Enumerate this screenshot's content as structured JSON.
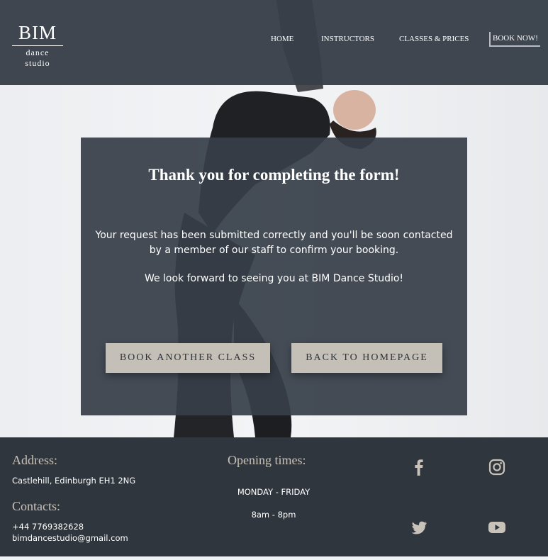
{
  "colors": {
    "header_bg": "#373e48",
    "card_bg": "#373e48",
    "footer_bg": "#30363e",
    "button_bg": "#c4bfb7",
    "footer_heading": "#c8c2b8",
    "text_light": "#ffffff"
  },
  "logo": {
    "title": "BIM",
    "subtitle": "dance studio"
  },
  "nav": {
    "home": "HOME",
    "instructors": "INSTRUCTORS",
    "classes": "CLASSES & PRICES",
    "book": "BOOK NOW!"
  },
  "card": {
    "title": "Thank you for completing the form!",
    "message_1": "Your request has been submitted correctly and you'll be soon contacted by a member of our staff to confirm your booking.",
    "message_2": "We look forward to seeing you at BIM Dance Studio!",
    "book_button": "BOOK ANOTHER CLASS",
    "home_button": "BACK TO HOMEPAGE"
  },
  "footer": {
    "address_heading": "Address:",
    "address": "Castlehill, Edinburgh EH1 2NG",
    "contacts_heading": "Contacts:",
    "phone": "+44 7769382628",
    "email": "bimdancestudio@gmail.com",
    "hours_heading": "Opening times:",
    "days": "MONDAY - FRIDAY",
    "time": "8am - 8pm",
    "social_icons": [
      "facebook-icon",
      "instagram-icon",
      "twitter-icon",
      "youtube-icon"
    ]
  }
}
